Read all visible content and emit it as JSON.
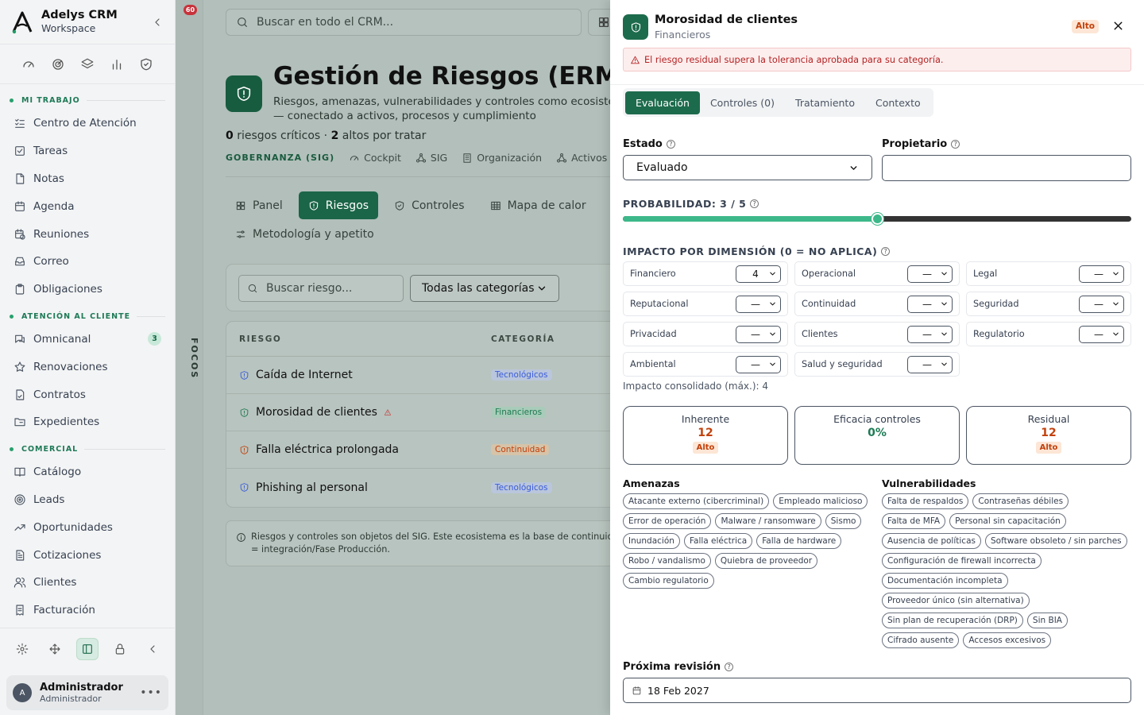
{
  "sidebar": {
    "brand_title": "Adelys CRM",
    "brand_sub": "Workspace",
    "sections": [
      {
        "title": "MI TRABAJO",
        "items": [
          {
            "label": "Centro de Atención",
            "icon": "list-check-icon"
          },
          {
            "label": "Tareas",
            "icon": "checkbox-icon"
          },
          {
            "label": "Notas",
            "icon": "note-icon"
          },
          {
            "label": "Agenda",
            "icon": "calendar-icon"
          },
          {
            "label": "Reuniones",
            "icon": "calendar-clock-icon"
          },
          {
            "label": "Correo",
            "icon": "inbox-icon"
          },
          {
            "label": "Obligaciones",
            "icon": "clipboard-icon"
          }
        ]
      },
      {
        "title": "ATENCIÓN AL CLIENTE",
        "items": [
          {
            "label": "Omnicanal",
            "icon": "chat-icon",
            "badge": "3"
          },
          {
            "label": "Renovaciones",
            "icon": "star-icon"
          },
          {
            "label": "Contratos",
            "icon": "contract-icon"
          },
          {
            "label": "Expedientes",
            "icon": "folder-icon"
          }
        ]
      },
      {
        "title": "COMERCIAL",
        "items": [
          {
            "label": "Catálogo",
            "icon": "book-icon"
          },
          {
            "label": "Leads",
            "icon": "target-icon"
          },
          {
            "label": "Oportunidades",
            "icon": "trend-icon"
          },
          {
            "label": "Cotizaciones",
            "icon": "document-icon"
          },
          {
            "label": "Clientes",
            "icon": "users-icon"
          },
          {
            "label": "Facturación",
            "icon": "invoice-icon"
          }
        ]
      }
    ],
    "user_initial": "A",
    "user_name": "Administrador",
    "user_role": "Administrador"
  },
  "focus": {
    "label": "FOCOS",
    "badge": "60"
  },
  "main": {
    "search_placeholder": "Buscar en todo el CRM...",
    "title": "Gestión de Riesgos (ERM)",
    "subtitle": "Riesgos, amenazas, vulnerabilidades y controles como ecosistema — conectado a activos, procesos y cumplimiento",
    "summary": {
      "critical_count": "0",
      "critical_text": "riesgos críticos ·",
      "high_count": "2",
      "high_text": "altos por tratar"
    },
    "gov_label": "GOBERNANZA (SIG)",
    "gov_links": [
      "Cockpit",
      "SIG",
      "Organización",
      "Activos"
    ],
    "tabs": [
      {
        "label": "Panel",
        "active": false
      },
      {
        "label": "Riesgos",
        "active": true
      },
      {
        "label": "Controles",
        "active": false
      },
      {
        "label": "Mapa de calor",
        "active": false
      },
      {
        "label": "Metodología y apetito",
        "active": false
      }
    ],
    "risk_search_placeholder": "Buscar riesgo...",
    "category_filter": "Todas las categorías",
    "table_headers": [
      "RIESGO",
      "CATEGORÍA"
    ],
    "rows": [
      {
        "name": "Caída de Internet",
        "category": "Tecnológicos",
        "color": "#3b5bdb",
        "chip_bg": "#b9c6dc",
        "warn": false
      },
      {
        "name": "Morosidad de clientes",
        "category": "Financieros",
        "color": "#1f7a52",
        "chip_bg": "#a8ccb9",
        "warn": true
      },
      {
        "name": "Falla eléctrica prolongada",
        "category": "Continuidad",
        "color": "#c2410c",
        "chip_bg": "#d6c3a8",
        "warn": false
      },
      {
        "name": "Phishing al personal",
        "category": "Tecnológicos",
        "color": "#3b5bdb",
        "chip_bg": "#b9c6dc",
        "warn": false
      }
    ],
    "info_text": "Riesgos y controles son objetos del SIG. Este ecosistema es la base de continuidad = integración/Fase Producción."
  },
  "drawer": {
    "title": "Morosidad de clientes",
    "subtitle": "Financieros",
    "level": "Alto",
    "alert": "El riesgo residual supera la tolerancia aprobada para su categoría.",
    "tabs": [
      {
        "label": "Evaluación",
        "active": true
      },
      {
        "label": "Controles (0)",
        "active": false
      },
      {
        "label": "Tratamiento",
        "active": false
      },
      {
        "label": "Contexto",
        "active": false
      }
    ],
    "estado_label": "Estado",
    "estado_value": "Evaluado",
    "propietario_label": "Propietario",
    "propietario_value": "",
    "probabilidad_label": "PROBABILIDAD: 3 / 5",
    "probabilidad": {
      "value": 3,
      "max": 5
    },
    "impact_label": "IMPACTO POR DIMENSIÓN (0 = NO APLICA)",
    "dimensions": [
      {
        "name": "Financiero",
        "value": "4"
      },
      {
        "name": "Operacional",
        "value": "—"
      },
      {
        "name": "Legal",
        "value": "—"
      },
      {
        "name": "Reputacional",
        "value": "—"
      },
      {
        "name": "Continuidad",
        "value": "—"
      },
      {
        "name": "Seguridad",
        "value": "—"
      },
      {
        "name": "Privacidad",
        "value": "—"
      },
      {
        "name": "Clientes",
        "value": "—"
      },
      {
        "name": "Regulatorio",
        "value": "—"
      },
      {
        "name": "Ambiental",
        "value": "—"
      },
      {
        "name": "Salud y seguridad",
        "value": "—"
      }
    ],
    "consolidated": "Impacto consolidado (máx.): 4",
    "scores": [
      {
        "label": "Inherente",
        "value": "12",
        "badge": "Alto",
        "color": "#c2410c"
      },
      {
        "label": "Eficacia controles",
        "value": "0%",
        "badge": "",
        "color": "#1d7a55"
      },
      {
        "label": "Residual",
        "value": "12",
        "badge": "Alto",
        "color": "#c2410c"
      }
    ],
    "threats_label": "Amenazas",
    "threats": [
      "Atacante externo (cibercriminal)",
      "Empleado malicioso",
      "Error de operación",
      "Malware / ransomware",
      "Sismo",
      "Inundación",
      "Falla eléctrica",
      "Falla de hardware",
      "Robo / vandalismo",
      "Quiebra de proveedor",
      "Cambio regulatorio"
    ],
    "vulns_label": "Vulnerabilidades",
    "vulns": [
      "Falta de respaldos",
      "Contraseñas débiles",
      "Falta de MFA",
      "Personal sin capacitación",
      "Ausencia de políticas",
      "Software obsoleto / sin parches",
      "Configuración de firewall incorrecta",
      "Documentación incompleta",
      "Proveedor único (sin alternativa)",
      "Sin plan de recuperación (DRP)",
      "Sin BIA",
      "Cifrado ausente",
      "Accesos excesivos"
    ],
    "review_label": "Próxima revisión",
    "review_date": "18 Feb 2027"
  }
}
